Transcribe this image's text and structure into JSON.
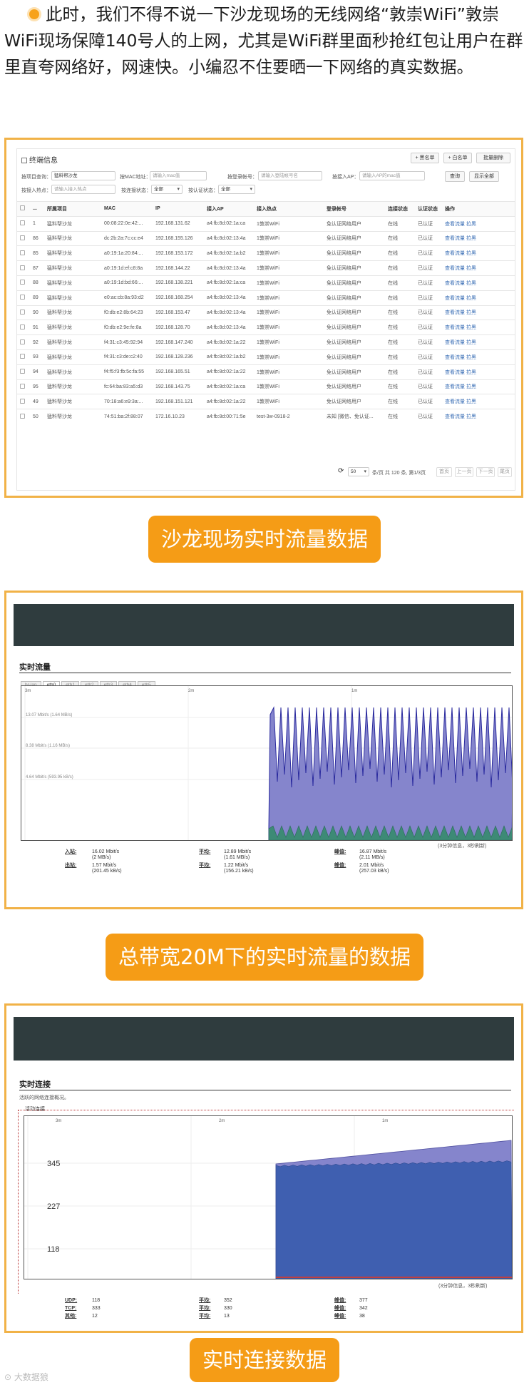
{
  "intro": {
    "text": "此时，我们不得不说一下沙龙现场的无线网络“敦崇WiFi”敦崇WiFi现场保障140号人的上网，尤其是WiFi群里面秒抢红包让用户在群里直夸网络好，网速快。小编忍不住要晒一下网络的真实数据。"
  },
  "terminal": {
    "title": "终端信息",
    "buttons": [
      "+ 黑名单",
      "+ 白名单",
      "批量删除"
    ],
    "filters": {
      "project_label": "按项目查询：",
      "project_value": "猛料帮沙龙",
      "mac_label": "按MAC地址：",
      "mac_placeholder": "请输入mac值",
      "account_label": "按登录帐号：",
      "account_placeholder": "请输入登陆帐号名",
      "ap_label": "按接入AP：",
      "ap_placeholder": "请输入AP的mac值",
      "query_button": "查询",
      "showall_button": "显示全部",
      "hotspot_label": "按接入热点：",
      "hotspot_placeholder": "请输入接入热点",
      "link_label": "按连接状态：",
      "link_value": "全部",
      "auth_label": "按认证状态：",
      "auth_value": "全部"
    },
    "columns": [
      "",
      "...",
      "所属项目",
      "MAC",
      "IP",
      "接入AP",
      "接入热点",
      "登录帐号",
      "连接状态",
      "认证状态",
      "操作"
    ],
    "rows": [
      [
        "1",
        "猛料帮沙龙",
        "00:08:22:0e:42:...",
        "192.168.131.62",
        "a4:fb:8d:02:1a:ca",
        "1敦崇WiFi",
        "免认证网络用户",
        "在线",
        "已认证",
        "查看流量 拉黑"
      ],
      [
        "86",
        "猛料帮沙龙",
        "dc:2b:2a:7c:cc:e4",
        "192.168.155.126",
        "a4:fb:8d:02:13:4a",
        "1敦崇WiFi",
        "免认证网络用户",
        "在线",
        "已认证",
        "查看流量 拉黑"
      ],
      [
        "85",
        "猛料帮沙龙",
        "a0:19:1a:20:84:...",
        "192.168.153.172",
        "a4:fb:8d:02:1a:b2",
        "1敦崇WiFi",
        "免认证网络用户",
        "在线",
        "已认证",
        "查看流量 拉黑"
      ],
      [
        "87",
        "猛料帮沙龙",
        "a0:19:1d:ef:c8:8a",
        "192.168.144.22",
        "a4:fb:8d:02:13:4a",
        "1敦崇WiFi",
        "免认证网络用户",
        "在线",
        "已认证",
        "查看流量 拉黑"
      ],
      [
        "88",
        "猛料帮沙龙",
        "a0:19:1d:bd:66:...",
        "192.168.138.221",
        "a4:fb:8d:02:1a:ca",
        "1敦崇WiFi",
        "免认证网络用户",
        "在线",
        "已认证",
        "查看流量 拉黑"
      ],
      [
        "89",
        "猛料帮沙龙",
        "e0:ac:cb:8a:93:d2",
        "192.168.168.254",
        "a4:fb:8d:02:13:4a",
        "1敦崇WiFi",
        "免认证网络用户",
        "在线",
        "已认证",
        "查看流量 拉黑"
      ],
      [
        "90",
        "猛料帮沙龙",
        "f0:db:e2:8b:64:23",
        "192.168.153.47",
        "a4:fb:8d:02:13:4a",
        "1敦崇WiFi",
        "免认证网络用户",
        "在线",
        "已认证",
        "查看流量 拉黑"
      ],
      [
        "91",
        "猛料帮沙龙",
        "f0:db:e2:9e:fe:8a",
        "192.168.128.70",
        "a4:fb:8d:02:13:4a",
        "1敦崇WiFi",
        "免认证网络用户",
        "在线",
        "已认证",
        "查看流量 拉黑"
      ],
      [
        "92",
        "猛料帮沙龙",
        "f4:31:c3:45:92:94",
        "192.168.147.240",
        "a4:fb:8d:02:1a:22",
        "1敦崇WiFi",
        "免认证网络用户",
        "在线",
        "已认证",
        "查看流量 拉黑"
      ],
      [
        "93",
        "猛料帮沙龙",
        "f4:31:c3:de:c2:40",
        "192.168.128.236",
        "a4:fb:8d:02:1a:b2",
        "1敦崇WiFi",
        "免认证网络用户",
        "在线",
        "已认证",
        "查看流量 拉黑"
      ],
      [
        "94",
        "猛料帮沙龙",
        "f4:f5:f3:fb:5c:fa:55",
        "192.168.165.51",
        "a4:fb:8d:02:1a:22",
        "1敦崇WiFi",
        "免认证网络用户",
        "在线",
        "已认证",
        "查看流量 拉黑"
      ],
      [
        "95",
        "猛料帮沙龙",
        "fc:64:ba:83:a5:d3",
        "192.168.143.75",
        "a4:fb:8d:02:1a:ca",
        "1敦崇WiFi",
        "免认证网络用户",
        "在线",
        "已认证",
        "查看流量 拉黑"
      ],
      [
        "49",
        "猛料帮沙龙",
        "70:18:a6:e9:3a:...",
        "192.168.151.121",
        "a4:fb:8d:02:1a:22",
        "1敦崇WiFi",
        "免认证网络用户",
        "在线",
        "已认证",
        "查看流量 拉黑"
      ],
      [
        "50",
        "猛料帮沙龙",
        "74:51:ba:2f:88:07",
        "172.16.10.23",
        "a4:fb:8d:00:71:5e",
        "test-3w-0918-2",
        "未知 [微信、免认证...",
        "在线",
        "已认证",
        "查看流量 拉黑"
      ]
    ],
    "pager": {
      "refresh": "⟳",
      "per_page": "50",
      "info": "条/页 共 120 条, 第1/3页",
      "first": "首页",
      "prev": "上一页",
      "next": "下一页",
      "last": "尾页"
    }
  },
  "caption1": "沙龙现场实时流量数据",
  "traffic": {
    "section_title": "实时流量",
    "tabs": [
      "br-lan",
      "eth0",
      "eth1",
      "eth2",
      "eth3",
      "eth4",
      "eth5"
    ],
    "active_tab": "eth0",
    "time_labels": [
      "3m",
      "2m",
      "1m"
    ],
    "y_labels": [
      "13.07 Mbit/s (1.64 MB/s)",
      "8.38 Mbit/s (1.16 MB/s)",
      "4.64 Mbit/s (593.95 kB/s)"
    ],
    "footer": "(3分钟信息，3秒刷新)",
    "stats": [
      {
        "key": "入站:",
        "cur": "16.02 Mbit/s",
        "cur2": "(2 MB/s)",
        "avg_label": "平均:",
        "avg": "12.89 Mbit/s",
        "avg2": "(1.61 MB/s)",
        "peak_label": "峰值:",
        "peak": "16.87 Mbit/s",
        "peak2": "(2.11 MB/s)"
      },
      {
        "key": "出站:",
        "cur": "1.57 Mbit/s",
        "cur2": "(201.45 kB/s)",
        "avg_label": "平均:",
        "avg": "1.22 Mbit/s",
        "avg2": "(156.21 kB/s)",
        "peak_label": "峰值:",
        "peak": "2.01 Mbit/s",
        "peak2": "(257.03 kB/s)"
      }
    ],
    "colors": {
      "inbound": "#8585cc",
      "inbound_line": "#2a2a9e",
      "outbound": "#3d8a76"
    }
  },
  "caption2": "总带宽20M下的实时流量的数据",
  "connections": {
    "section_title": "实时连接",
    "subtitle": "活跃的网络连接概况。",
    "legend": "活动连接",
    "time_labels": [
      "3m",
      "2m",
      "1m"
    ],
    "y_labels": [
      "345",
      "227",
      "118"
    ],
    "footer": "(3分钟信息，3秒刷新)",
    "stats": [
      {
        "key": "UDP:",
        "cur": "118",
        "avg_label": "平均:",
        "avg": "352",
        "peak_label": "峰值:",
        "peak": "377"
      },
      {
        "key": "TCP:",
        "cur": "333",
        "avg_label": "平均:",
        "avg": "330",
        "peak_label": "峰值:",
        "peak": "342"
      },
      {
        "key": "其他:",
        "cur": "12",
        "avg_label": "平均:",
        "avg": "13",
        "peak_label": "峰值:",
        "peak": "38"
      }
    ],
    "colors": {
      "udp": "#8585cc",
      "tcp": "#3f5fb0",
      "other": "#c04040"
    }
  },
  "caption3": "实时连接数据",
  "watermark": "大数据狼"
}
